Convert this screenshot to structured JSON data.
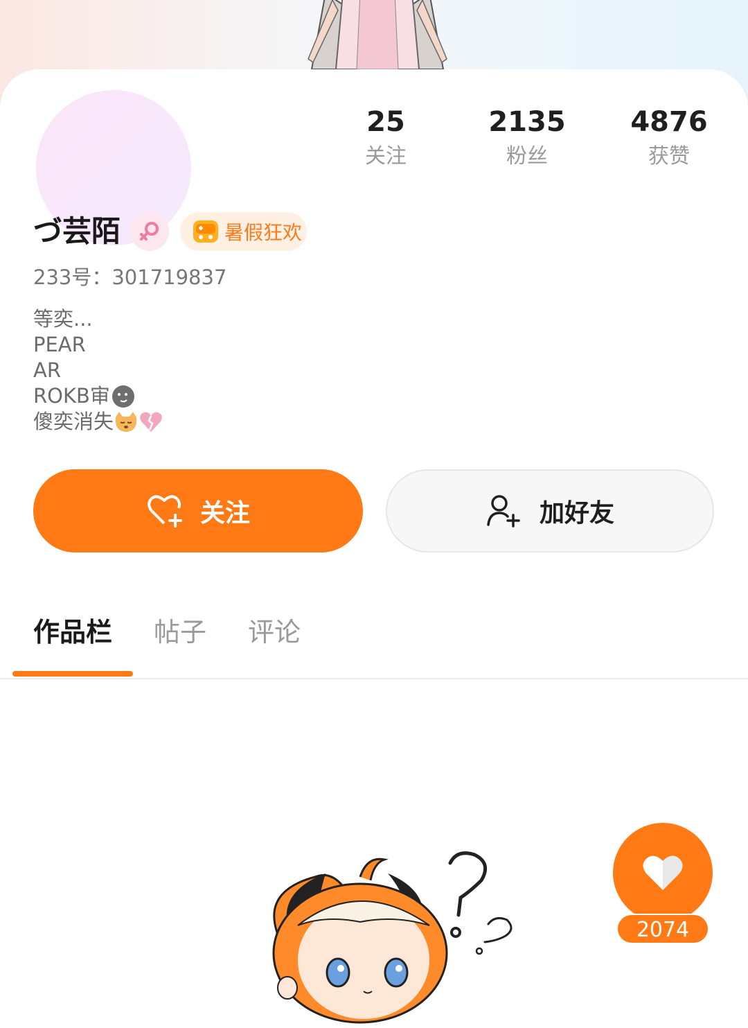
{
  "profile": {
    "name": "づ芸陌",
    "event_badge": "暑假狂欢",
    "uid": "233号：301719837",
    "bio": [
      "等奕...",
      "PEAR",
      "AR",
      "ROKB审",
      "傻奕消失"
    ]
  },
  "stats": [
    {
      "value": "25",
      "label": "关注"
    },
    {
      "value": "2135",
      "label": "粉丝"
    },
    {
      "value": "4876",
      "label": "获赞"
    }
  ],
  "actions": {
    "follow_label": "关注",
    "add_friend_label": "加好友"
  },
  "tabs": [
    "作品栏",
    "帖子",
    "评论"
  ],
  "like": {
    "count": "2074"
  },
  "colors": {
    "accent": "#ff7a14",
    "gender": "#f07aa0"
  },
  "icons": [
    "heart-plus-icon",
    "person-plus-icon",
    "female-icon",
    "game-controller-icon",
    "heart-icon"
  ]
}
